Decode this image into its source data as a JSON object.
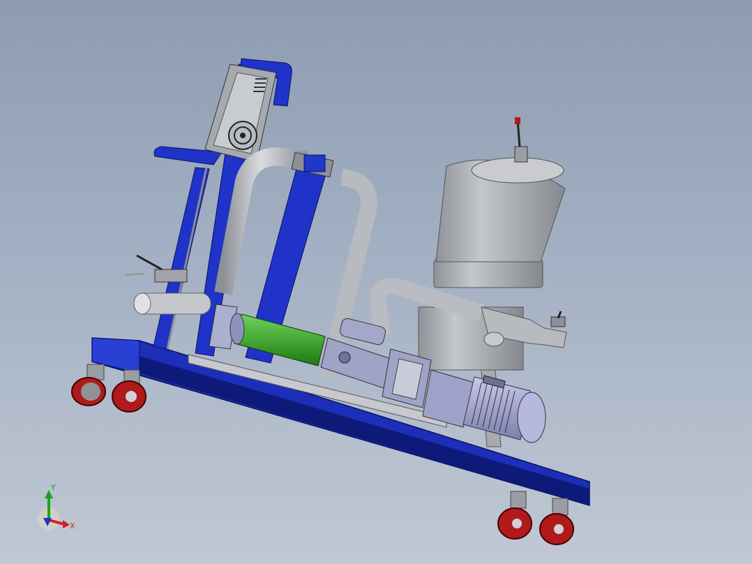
{
  "viewport": {
    "background_top": "#8d9cb2",
    "background_bottom": "#c0c8d4"
  },
  "colors": {
    "frame_blue": "#1d2fb8",
    "frame_blue_dark": "#0e1a7a",
    "pipe_gray": "#b9bcc2",
    "tank_gray": "#a9acb1",
    "tube_green": "#2fa31e",
    "wheel_red": "#b01a1a",
    "motor_lavender": "#a9aad2"
  },
  "triad": {
    "x_label": "X",
    "y_label": "Y",
    "x_color": "#d42020",
    "y_color": "#1aa31a",
    "z_color": "#2430c8"
  }
}
